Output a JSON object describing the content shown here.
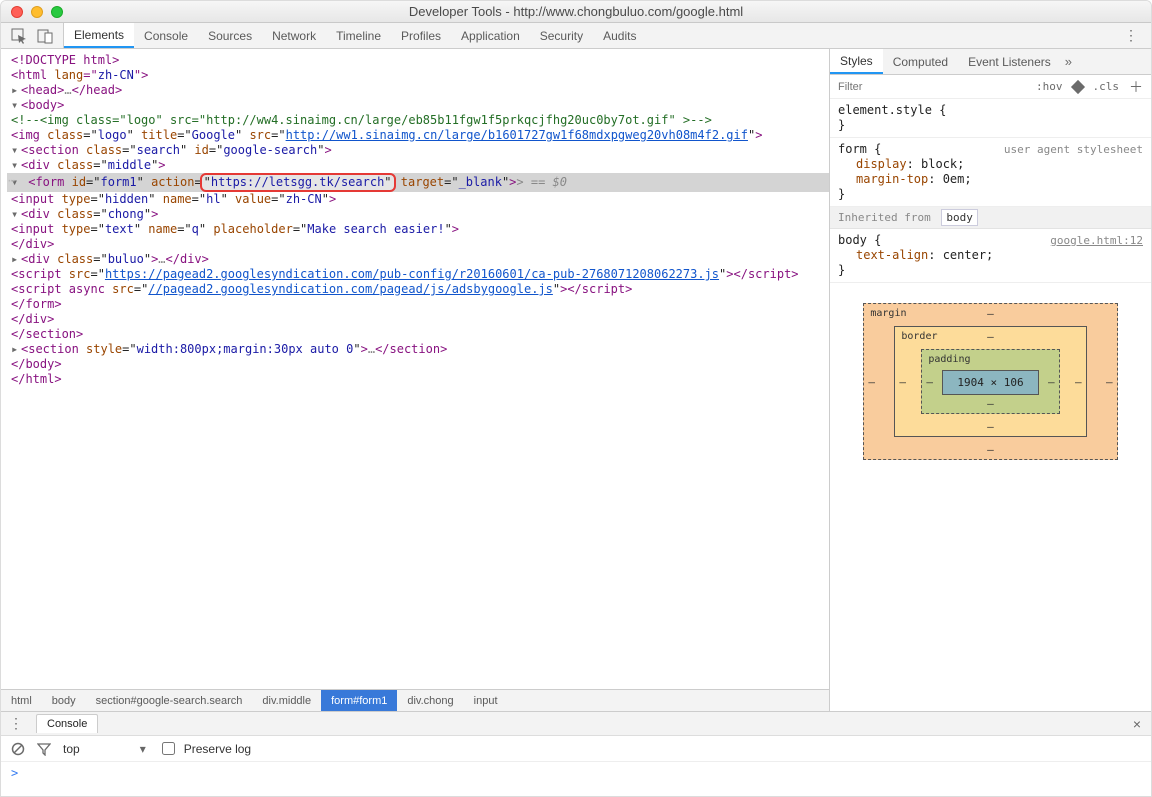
{
  "window": {
    "title": "Developer Tools - http://www.chongbuluo.com/google.html"
  },
  "toolbar_tabs": [
    "Elements",
    "Console",
    "Sources",
    "Network",
    "Timeline",
    "Profiles",
    "Application",
    "Security",
    "Audits"
  ],
  "toolbar_active": "Elements",
  "dom": {
    "l1": "<!DOCTYPE html>",
    "l2_open": "<html ",
    "l2_attr_n": "lang",
    "l2_attr_v": "zh-CN",
    "l2_close": ">",
    "head_open": "<head>",
    "head_ell": "…",
    "head_close": "</head>",
    "body_open": "<body>",
    "comment": "<!--<img class=\"logo\" src=\"http://ww4.sinaimg.cn/large/eb85b11fgw1f5prkqcjfhg20uc0by7ot.gif\" >-->",
    "img_open": "<img ",
    "img_a1n": "class",
    "img_a1v": "logo",
    "img_a2n": "title",
    "img_a2v": "Google",
    "img_a3n": "src",
    "img_a3v": "http://ww1.sinaimg.cn/large/b1601727gw1f68mdxpgweg20vh08m4f2.gif",
    "img_close": ">",
    "sec_open": "<section ",
    "sec_a1n": "class",
    "sec_a1v": "search",
    "sec_a2n": "id",
    "sec_a2v": "google-search",
    "sec_close": ">",
    "mid_open": "<div ",
    "mid_a1n": "class",
    "mid_a1v": "middle",
    "mid_close": ">",
    "form_open": "<form ",
    "form_a1n": "id",
    "form_a1v": "form1",
    "form_a2n": "action",
    "form_a2v": "https://letsgg.tk/search",
    "form_a3n": "target",
    "form_a3v": "_blank",
    "form_close_tail": "> == ",
    "form_dollar": "$0",
    "hidden": "<input type=\"hidden\" name=\"hl\" value=\"zh-CN\">",
    "chong_open": "<div ",
    "chong_a1n": "class",
    "chong_a1v": "chong",
    "chong_close": ">",
    "input_open": "<input ",
    "in_a1n": "type",
    "in_a1v": "text",
    "in_a2n": "name",
    "in_a2v": "q",
    "in_a3n": "placeholder",
    "in_a3v": "Make search easier!",
    "in_close": ">",
    "chong_end": "</div>",
    "buluo_open": "<div ",
    "buluo_a1n": "class",
    "buluo_a1v": "buluo",
    "buluo_close": ">…</div>",
    "script1_open": "<script ",
    "script1_a1n": "src",
    "script1_a1v": "https://pagead2.googlesyndication.com/pub-config/r20160601/ca-pub-2768071208062273.js",
    "script1_close": "></script>",
    "script2_open": "<script async ",
    "script2_a1n": "src",
    "script2_a1v": "//pagead2.googlesyndication.com/pagead/js/adsbygoogle.js",
    "script2_close": "></script>",
    "form_end": "</form>",
    "mid_end": "</div>",
    "sec_end": "</section>",
    "sec2_open": "<section ",
    "sec2_a1n": "style",
    "sec2_a1v": "width:800px;margin:30px auto 0",
    "sec2_close": ">…</section>",
    "body_end": "</body>",
    "html_end": "</html>"
  },
  "crumbs": [
    "html",
    "body",
    "section#google-search.search",
    "div.middle",
    "form#form1",
    "div.chong",
    "input"
  ],
  "crumb_active": "form#form1",
  "styles": {
    "tabs": [
      "Styles",
      "Computed",
      "Event Listeners"
    ],
    "tabs_active": "Styles",
    "filter_placeholder": "Filter",
    "tool_hov": ":hov",
    "tool_cls": ".cls",
    "rule_elem_sel": "element.style {",
    "rule_elem_end": "}",
    "rule_form_sel": "form {",
    "rule_form_ua": "user agent stylesheet",
    "rule_form_p1n": "display",
    "rule_form_p1v": "block;",
    "rule_form_p2n": "margin-top",
    "rule_form_p2v": "0em;",
    "rule_form_end": "}",
    "inh_label": "Inherited from",
    "inh_from": "body",
    "rule_body_sel": "body {",
    "rule_body_src": "google.html:12",
    "rule_body_p1n": "text-align",
    "rule_body_p1v": "center;",
    "rule_body_end": "}",
    "bm_margin": "margin",
    "bm_border": "border",
    "bm_padding": "padding",
    "bm_content": "1904 × 106",
    "bm_dash": "–"
  },
  "drawer": {
    "tab": "Console",
    "context": "top",
    "preserve": "Preserve log",
    "prompt": ">"
  }
}
